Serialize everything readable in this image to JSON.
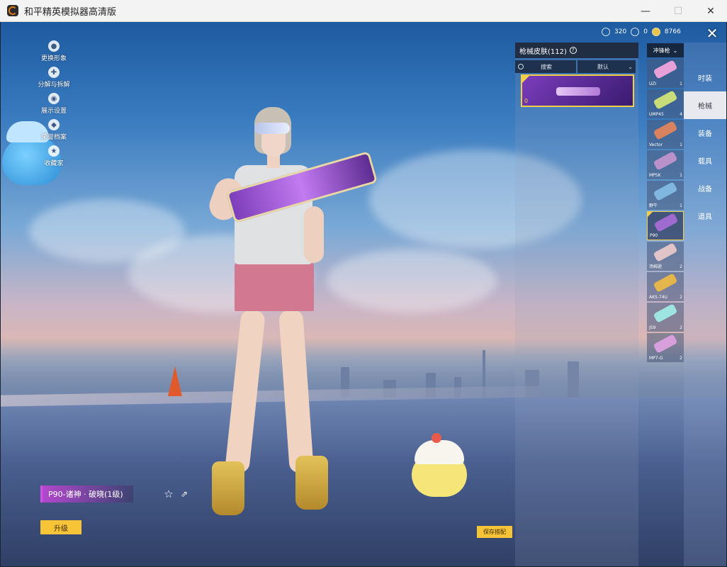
{
  "window": {
    "title": "和平精英模拟器高清版",
    "minimize": "—",
    "maximize": "☐",
    "close": "✕"
  },
  "left_menu": [
    {
      "label": "更换形象",
      "icon": "avatar-icon"
    },
    {
      "label": "分解与拆解",
      "icon": "puzzle-icon"
    },
    {
      "label": "展示设置",
      "icon": "eye-icon"
    },
    {
      "label": "荣誉档案",
      "icon": "medal-icon"
    },
    {
      "label": "收藏家",
      "icon": "collector-icon"
    }
  ],
  "currency": [
    {
      "icon": "coupon-icon",
      "value": "320"
    },
    {
      "icon": "badge-icon",
      "value": "0"
    },
    {
      "icon": "gold-icon",
      "value": "8766"
    }
  ],
  "close_symbol": "✕",
  "skin_panel": {
    "title": "枪械皮肤(112)",
    "help": "?",
    "search_label": "搜索",
    "sort_label": "默认",
    "selected_skin_level": "0"
  },
  "weapon_filter": "冲锋枪",
  "weapons": [
    {
      "name": "UZI",
      "count": "1",
      "color": "#e7a0d8",
      "selected": false
    },
    {
      "name": "UMP45",
      "count": "4",
      "color": "#c9dc7a",
      "selected": false
    },
    {
      "name": "Vector",
      "count": "1",
      "color": "#d8825f",
      "selected": false
    },
    {
      "name": "MP5K",
      "count": "1",
      "color": "#b992c9",
      "selected": false
    },
    {
      "name": "野牛",
      "count": "1",
      "color": "#7fb7e0",
      "selected": false
    },
    {
      "name": "P90",
      "count": "",
      "color": "#a06bd0",
      "selected": true
    },
    {
      "name": "汤姆逊",
      "count": "2",
      "color": "#e0c4c8",
      "selected": false
    },
    {
      "name": "AKS-74U",
      "count": "2",
      "color": "#e3b54a",
      "selected": false
    },
    {
      "name": "JS9",
      "count": "2",
      "color": "#9ee4e0",
      "selected": false
    },
    {
      "name": "MP7-G",
      "count": "2",
      "color": "#d7a0dc",
      "selected": false
    }
  ],
  "categories": [
    {
      "label": "时装",
      "active": false
    },
    {
      "label": "枪械",
      "active": true
    },
    {
      "label": "装备",
      "active": false
    },
    {
      "label": "载具",
      "active": false
    },
    {
      "label": "战备",
      "active": false
    },
    {
      "label": "道具",
      "active": false
    }
  ],
  "selected_skin": {
    "name": "P90-诸神 · 破晓(1级)"
  },
  "buttons": {
    "favorite": "☆",
    "share": "⇗",
    "upgrade": "升级",
    "save_outfit": "保存搭配"
  },
  "colors": {
    "accent_gold": "#f7c437",
    "skin_purple": "#b946d2"
  }
}
